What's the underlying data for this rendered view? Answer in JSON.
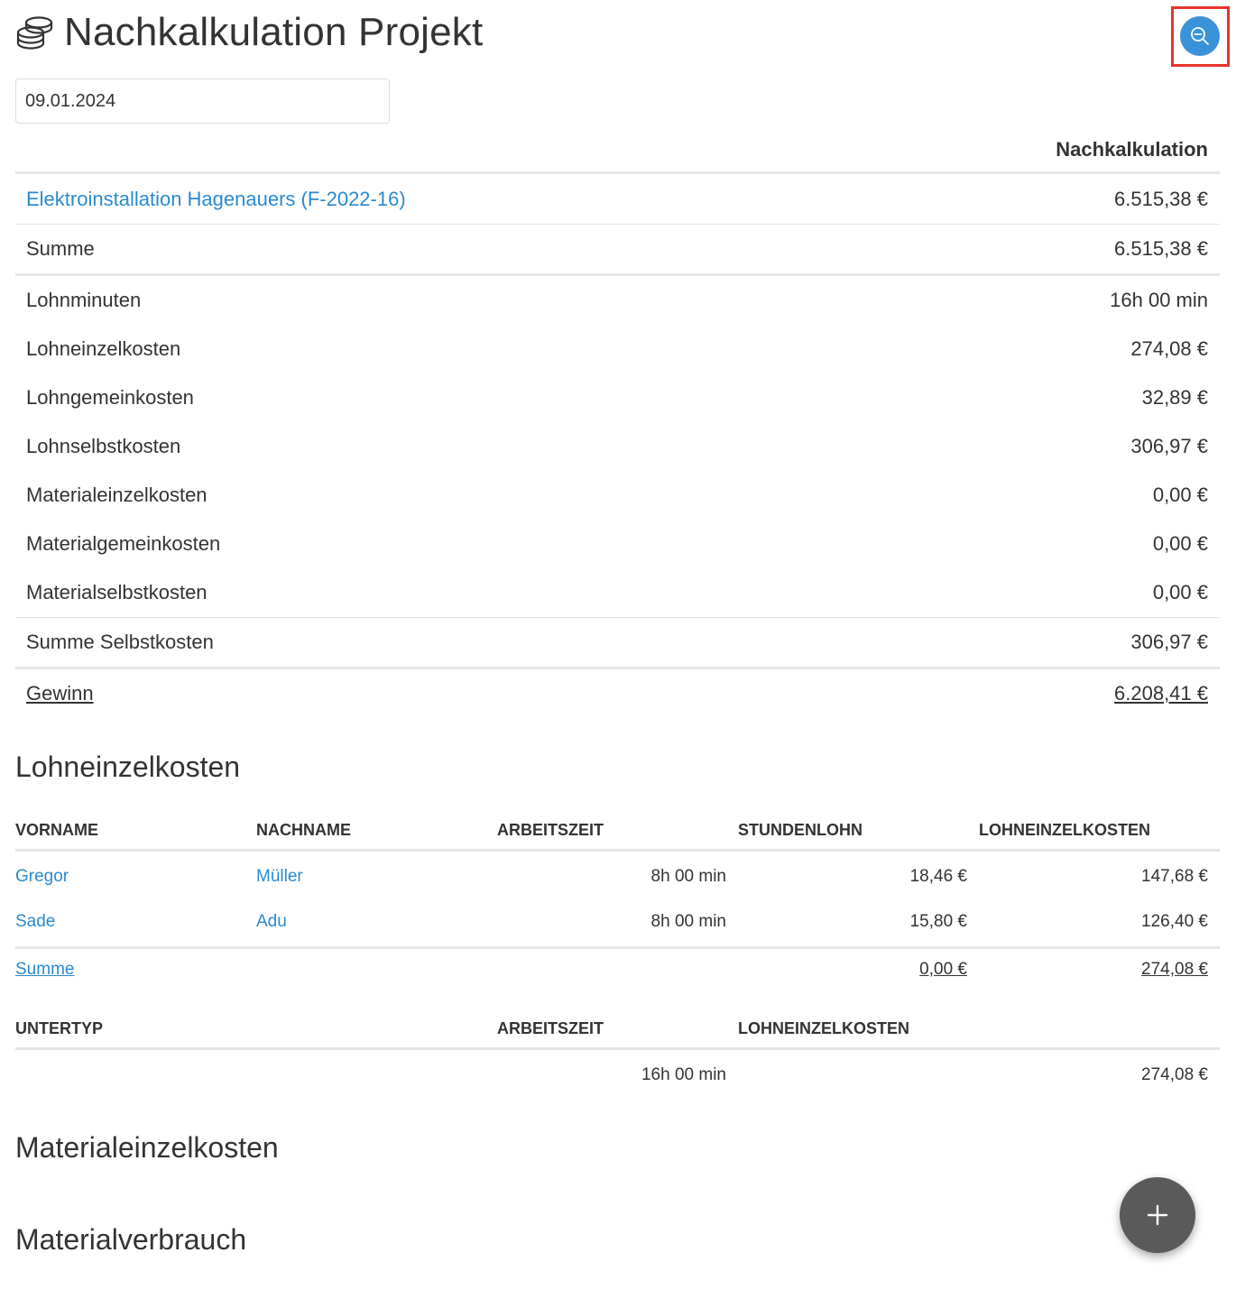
{
  "header": {
    "title": "Nachkalkulation Projekt",
    "icon": "coins-icon"
  },
  "toolbar": {
    "zoom_icon": "zoom-out-icon"
  },
  "date": {
    "value": "09.01.2024"
  },
  "calc": {
    "column_label": "Nachkalkulation",
    "project": {
      "label": "Elektroinstallation Hagenauers (F-2022-16)",
      "value": "6.515,38 €"
    },
    "sum": {
      "label": "Summe",
      "value": "6.515,38 €"
    },
    "rows": [
      {
        "label": "Lohnminuten",
        "value": "16h 00 min"
      },
      {
        "label": "Lohneinzelkosten",
        "value": "274,08 €"
      },
      {
        "label": "Lohngemeinkosten",
        "value": "32,89 €"
      },
      {
        "label": "Lohnselbstkosten",
        "value": "306,97 €"
      },
      {
        "label": "Materialeinzelkosten",
        "value": "0,00 €"
      },
      {
        "label": "Materialgemeinkosten",
        "value": "0,00 €"
      },
      {
        "label": "Materialselbstkosten",
        "value": "0,00 €"
      }
    ],
    "total_costs": {
      "label": "Summe Selbstkosten",
      "value": "306,97 €"
    },
    "profit": {
      "label": "Gewinn",
      "value": "6.208,41 €"
    }
  },
  "labor": {
    "title": "Lohneinzelkosten",
    "headers": [
      "VORNAME",
      "NACHNAME",
      "ARBEITSZEIT",
      "STUNDENLOHN",
      "LOHNEINZELKOSTEN"
    ],
    "rows": [
      {
        "first": "Gregor",
        "last": "Müller",
        "time": "8h 00 min",
        "rate": "18,46 €",
        "cost": "147,68 €"
      },
      {
        "first": "Sade",
        "last": "Adu",
        "time": "8h 00 min",
        "rate": "15,80 €",
        "cost": "126,40 €"
      }
    ],
    "sum": {
      "label": "Summe",
      "rate": "0,00 €",
      "cost": "274,08 €"
    },
    "subtype_headers": [
      "UNTERTYP",
      "ARBEITSZEIT",
      "LOHNEINZELKOSTEN"
    ],
    "subtype_row": {
      "subtype": "",
      "time": "16h 00 min",
      "cost": "274,08 €"
    }
  },
  "material": {
    "title": "Materialeinzelkosten"
  },
  "consumption": {
    "title": "Materialverbrauch"
  },
  "fab": {
    "icon": "plus-icon"
  }
}
